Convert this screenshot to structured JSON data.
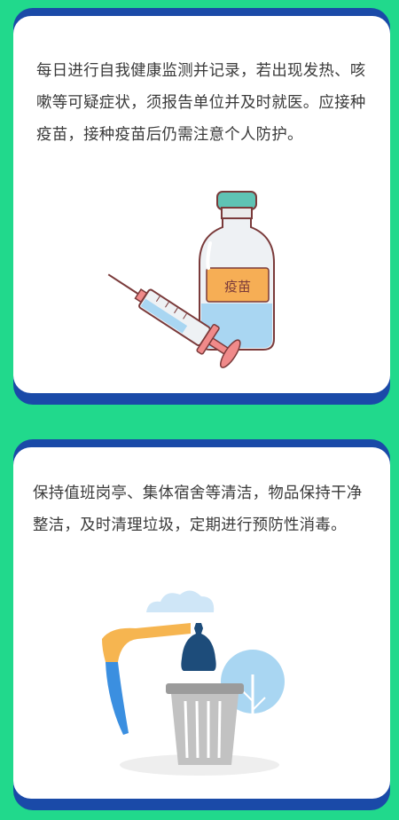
{
  "cards": [
    {
      "text": "每日进行自我健康监测并记录，若出现发热、咳嗽等可疑症状，须报告单位并及时就医。应接种疫苗，接种疫苗后仍需注意个人防护。",
      "illustration": "vaccine-bottle-and-syringe",
      "label": "疫苗"
    },
    {
      "text": "保持值班岗亭、集体宿舍等清洁，物品保持干净整洁，及时清理垃圾，定期进行预防性消毒。",
      "illustration": "trash-can-with-garbage-bag"
    }
  ],
  "colors": {
    "background": "#21d98c",
    "card_border": "#1a4aa8",
    "card": "#ffffff",
    "text": "#3a3a3a"
  }
}
